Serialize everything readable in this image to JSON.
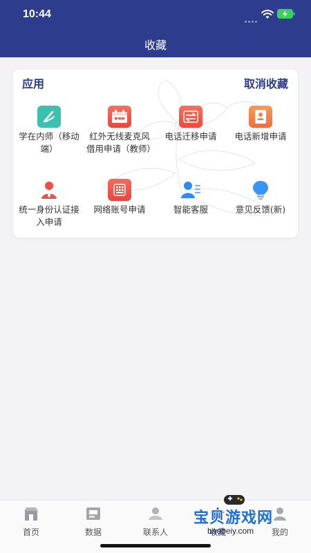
{
  "status_bar": {
    "time": "10:44"
  },
  "header": {
    "title": "收藏"
  },
  "card": {
    "title": "应用",
    "action_label": "取消收藏",
    "items": [
      {
        "label": "学在内师（移动端）",
        "icon": "pen-icon",
        "color": "#38bfae"
      },
      {
        "label": "红外无线麦克风借用申请（教师）",
        "icon": "calendar-icon",
        "color": "#f25a4b"
      },
      {
        "label": "电话迁移申请",
        "icon": "transfer-box-icon",
        "color": "#f15a45"
      },
      {
        "label": "电话新增申请",
        "icon": "contact-card-icon",
        "color": "#f5824a"
      },
      {
        "label": "统一身份认证接入申请",
        "icon": "user-tie-icon",
        "color": "#ef4f46"
      },
      {
        "label": "网络账号申请",
        "icon": "grid-card-icon",
        "color": "#f0554c"
      },
      {
        "label": "智能客服",
        "icon": "service-agent-icon",
        "color": "#2f8bf0"
      },
      {
        "label": "意见反馈(新)",
        "icon": "lightbulb-icon",
        "color": "#3a94f2"
      }
    ]
  },
  "tabbar": {
    "items": [
      {
        "label": "首页",
        "icon": "home-store-icon"
      },
      {
        "label": "数据",
        "icon": "data-box-icon"
      },
      {
        "label": "联系人",
        "icon": "contacts-icon"
      },
      {
        "label": "收藏",
        "icon": "star-icon"
      },
      {
        "label": "我的",
        "icon": "profile-icon"
      }
    ]
  },
  "watermark": {
    "text": "宝贝游戏网",
    "url": "baobeiy.com"
  }
}
